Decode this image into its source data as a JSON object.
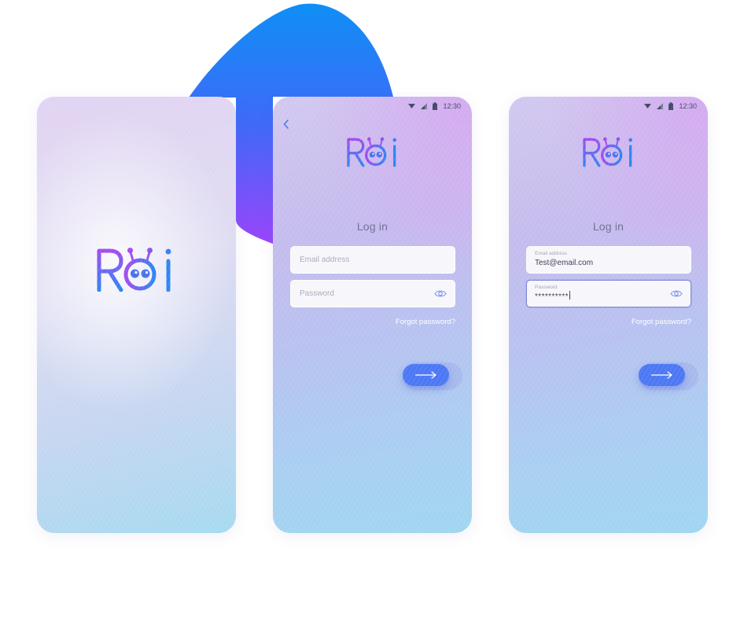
{
  "brand": {
    "logo_text": "Roi",
    "gradient_start": "#a24bf0",
    "gradient_end": "#2d86f2"
  },
  "colors": {
    "blob_top": "#0f8ff6",
    "blob_bottom": "#9a45fb",
    "button": "#4d78f4",
    "focus_border": "#7b86d6"
  },
  "status_bar": {
    "time": "12:30",
    "icons": [
      "wifi-icon",
      "signal-icon",
      "battery-icon"
    ]
  },
  "screens": {
    "splash": {},
    "login_empty": {
      "title": "Log in",
      "email_placeholder": "Email address",
      "password_placeholder": "Password",
      "forgot": "Forgot password?",
      "back_icon": "chevron-left-icon",
      "eye_icon": "eye-icon",
      "submit_icon": "arrow-right-icon"
    },
    "login_filled": {
      "title": "Log in",
      "email_label": "Email address",
      "email_value": "Test@email.com",
      "password_label": "Password",
      "password_value": "**********",
      "forgot": "Forgot password?",
      "eye_icon": "eye-icon",
      "submit_icon": "arrow-right-icon"
    }
  }
}
